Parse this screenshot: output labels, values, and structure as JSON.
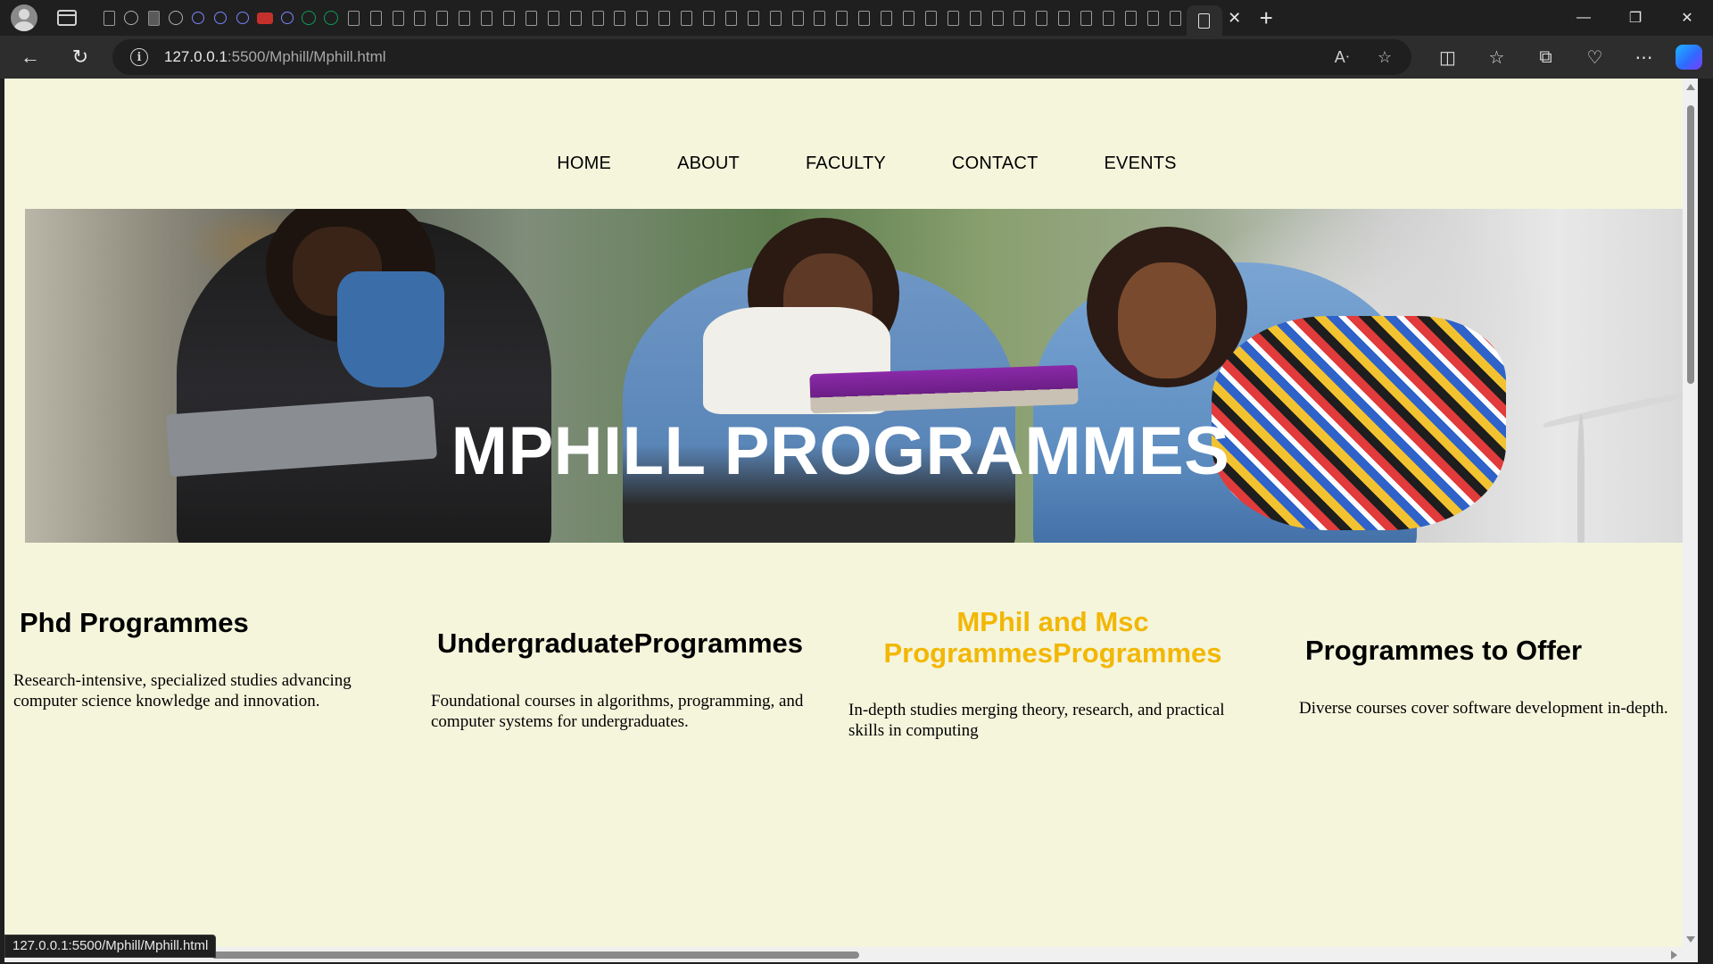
{
  "browser": {
    "url_host": "127.0.0.1",
    "url_path": ":5500/Mphill/Mphill.html",
    "status_url": "127.0.0.1:5500/Mphill/Mphill.html",
    "icons": {
      "back": "arrow-left-icon",
      "refresh": "refresh-icon",
      "info": "info-icon",
      "read_aloud": "read-aloud-icon",
      "favorite": "star-icon",
      "split": "split-screen-icon",
      "favorites": "favorites-icon",
      "collections": "collections-icon",
      "health": "browser-essentials-icon",
      "more": "more-icon",
      "copilot": "copilot-icon"
    }
  },
  "nav": {
    "items": [
      "HOME",
      "ABOUT",
      "FACULTY",
      "CONTACT",
      "EVENTS"
    ]
  },
  "hero": {
    "title": "MPHILL PROGRAMMES"
  },
  "cards": [
    {
      "title": "Phd Programmes",
      "text": "Research-intensive, specialized studies advancing computer science knowledge and innovation."
    },
    {
      "title": "UndergraduateProgrammes",
      "text": "Foundational courses in algorithms, programming, and computer systems for undergraduates."
    },
    {
      "title": "MPhil and Msc ProgrammesProgrammes",
      "text": "In-depth studies merging theory, research, and practical skills in computing"
    },
    {
      "title": "Programmes to Offer",
      "text": "Diverse courses cover software development in-depth."
    }
  ],
  "colors": {
    "page_background": "#f5f5dc",
    "highlight_title": "#f2b705"
  }
}
